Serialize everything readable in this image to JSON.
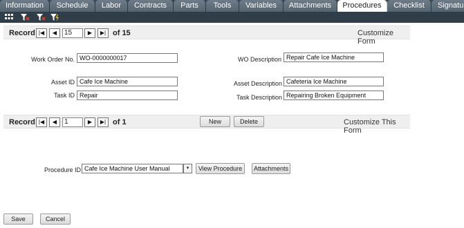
{
  "tabs": [
    "Information",
    "Schedule",
    "Labor",
    "Contracts",
    "Parts",
    "Tools",
    "Variables",
    "Attachments",
    "Procedures",
    "Checklist",
    "Signatur"
  ],
  "active_tab": "Procedures",
  "toolbar_icons": [
    "grid-icon",
    "filter-icon",
    "filter-clear-icon",
    "filter-lightning-icon"
  ],
  "record_bar_top": {
    "label": "Record:",
    "current": "15",
    "of": "of 15",
    "customize": "Customize Form"
  },
  "work_order": {
    "wo_no_label": "Work Order No.",
    "wo_no_value": "WO-0000000017",
    "wo_desc_label": "WO Description",
    "wo_desc_value": "Repair Cafe Ice Machine",
    "asset_id_label": "Asset ID",
    "asset_id_value": "Cafe Ice Machine",
    "asset_desc_label": "Asset Description",
    "asset_desc_value": "Cafeteria Ice Machine",
    "task_id_label": "Task ID",
    "task_id_value": "Repair",
    "task_desc_label": "Task Description",
    "task_desc_value": "Repairing Broken Equipment"
  },
  "record_bar_bottom": {
    "label": "Record:",
    "current": "1",
    "of": "of 1",
    "new_label": "New",
    "delete_label": "Delete",
    "customize": "Customize This Form"
  },
  "procedure": {
    "label": "Procedure ID",
    "value": "Cafe Ice Machine User Manual",
    "view_label": "View Procedure",
    "attachments_label": "Attachments"
  },
  "footer": {
    "save_label": "Save",
    "cancel_label": "Cancel"
  },
  "nav_glyphs": {
    "first": "|◀",
    "prev": "◀",
    "next": "▶",
    "last": "▶|",
    "dropdown": "▾"
  }
}
